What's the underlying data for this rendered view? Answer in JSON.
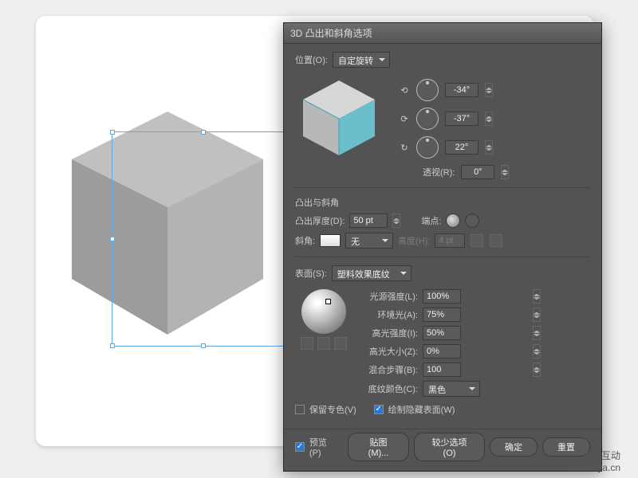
{
  "dialog": {
    "title": "3D 凸出和斜角选项",
    "position": {
      "label": "位置(O):",
      "value": "自定旋转"
    },
    "rotation": {
      "x_sym": "⟲",
      "x_val": "-34°",
      "y_sym": "⟳",
      "y_val": "-37°",
      "z_sym": "↻",
      "z_val": "22°",
      "perspective_label": "透视(R):",
      "perspective_val": "0°"
    },
    "extrude": {
      "section": "凸出与斜角",
      "depth_label": "凸出厚度(D):",
      "depth_val": "50 pt",
      "cap_label": "端点:",
      "bevel_label": "斜角:",
      "bevel_val": "无",
      "height_label": "高度(H):",
      "height_val": "4 pt"
    },
    "surface": {
      "section_label": "表面(S):",
      "shader": "塑料效果底纹",
      "light_intensity_label": "光源强度(L):",
      "light_intensity_val": "100%",
      "ambient_label": "环境光(A):",
      "ambient_val": "75%",
      "highlight_intensity_label": "高光强度(I):",
      "highlight_intensity_val": "50%",
      "highlight_size_label": "高光大小(Z):",
      "highlight_size_val": "0%",
      "blend_steps_label": "混合步骤(B):",
      "blend_steps_val": "100",
      "shade_color_label": "底纹颜色(C):",
      "shade_color_val": "黑色"
    },
    "options": {
      "preserve_spot_label": "保留专色(V)",
      "draw_hidden_label": "绘制隐藏表面(W)"
    },
    "footer": {
      "preview_label": "预览(P)",
      "map_art": "贴图(M)...",
      "fewer_opts": "较少选项(O)",
      "ok": "确定",
      "reset": "重置"
    }
  },
  "watermark": {
    "line1": "思洋互动",
    "line2": "www.ciya.cn"
  }
}
